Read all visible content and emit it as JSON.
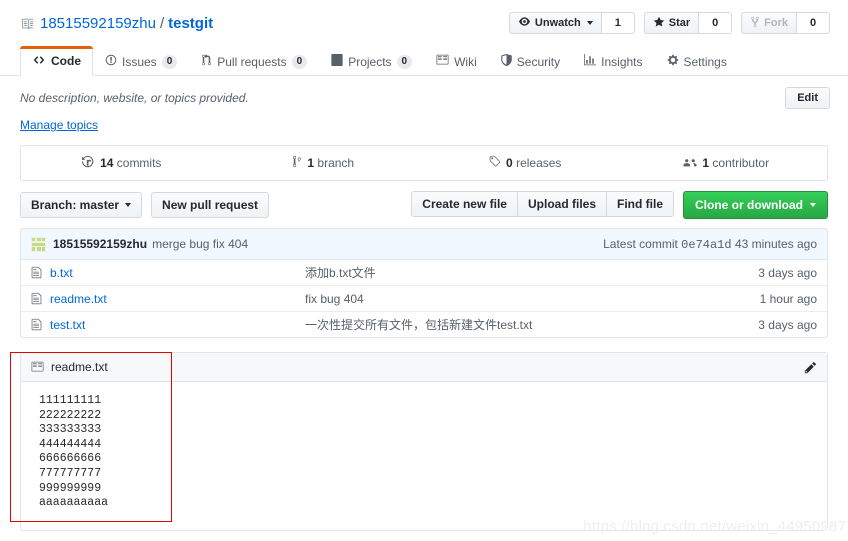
{
  "header": {
    "repo_icon": "repository-book-icon",
    "owner": "18515592159zhu",
    "separator": "/",
    "name": "testgit",
    "actions": [
      {
        "icon": "eye-icon",
        "label": "Unwatch",
        "count": "1",
        "has_caret": true,
        "disabled": false
      },
      {
        "icon": "star-icon",
        "label": "Star",
        "count": "0",
        "has_caret": false,
        "disabled": false
      },
      {
        "icon": "fork-icon",
        "label": "Fork",
        "count": "0",
        "has_caret": false,
        "disabled": true
      }
    ]
  },
  "tabs": [
    {
      "icon": "code-icon",
      "label": "Code",
      "count": null,
      "active": true
    },
    {
      "icon": "issue-opened-icon",
      "label": "Issues",
      "count": "0",
      "active": false
    },
    {
      "icon": "git-pull-request-icon",
      "label": "Pull requests",
      "count": "0",
      "active": false
    },
    {
      "icon": "project-board-icon",
      "label": "Projects",
      "count": "0",
      "active": false
    },
    {
      "icon": "book-icon",
      "label": "Wiki",
      "count": null,
      "active": false
    },
    {
      "icon": "shield-icon",
      "label": "Security",
      "count": null,
      "active": false
    },
    {
      "icon": "graph-icon",
      "label": "Insights",
      "count": null,
      "active": false
    },
    {
      "icon": "gear-icon",
      "label": "Settings",
      "count": null,
      "active": false
    }
  ],
  "description": {
    "text": "No description, website, or topics provided.",
    "manage_topics_label": "Manage topics",
    "edit_label": "Edit"
  },
  "stats": [
    {
      "icon": "history-icon",
      "count": "14",
      "label": "commits"
    },
    {
      "icon": "branch-icon",
      "count": "1",
      "label": "branch"
    },
    {
      "icon": "tag-icon",
      "count": "0",
      "label": "releases"
    },
    {
      "icon": "people-icon",
      "count": "1",
      "label": "contributor"
    }
  ],
  "toolbar": {
    "branch_label": "Branch: master",
    "new_pull_request_label": "New pull request",
    "create_new_file_label": "Create new file",
    "upload_files_label": "Upload files",
    "find_file_label": "Find file",
    "clone_label": "Clone or download"
  },
  "latest_commit": {
    "avatar": "identicon-avatar",
    "author": "18515592159zhu",
    "message": "merge bug fix 404",
    "meta_prefix": "Latest commit",
    "sha": "0e74a1d",
    "time": "43 minutes ago"
  },
  "files": {
    "columns": [
      "name",
      "message",
      "age"
    ],
    "rows": [
      {
        "icon": "file-icon",
        "name": "b.txt",
        "message": "添加b.txt文件",
        "age": "3 days ago"
      },
      {
        "icon": "file-icon",
        "name": "readme.txt",
        "message": "fix bug 404",
        "age": "1 hour ago"
      },
      {
        "icon": "file-icon",
        "name": "test.txt",
        "message": "一次性提交所有文件，包括新建文件test.txt",
        "age": "3 days ago"
      }
    ]
  },
  "readme": {
    "icon": "book-readme-icon",
    "title": "readme.txt",
    "edit_icon": "pencil-icon",
    "content": "111111111\n222222222\n333333333\n444444444\n666666666\n777777777\n999999999\naaaaaaaaaa"
  },
  "annotation": {
    "highlight_color": "#e60000"
  },
  "watermark": {
    "text": "https://blog.csdn.net/weixin_44950987"
  }
}
